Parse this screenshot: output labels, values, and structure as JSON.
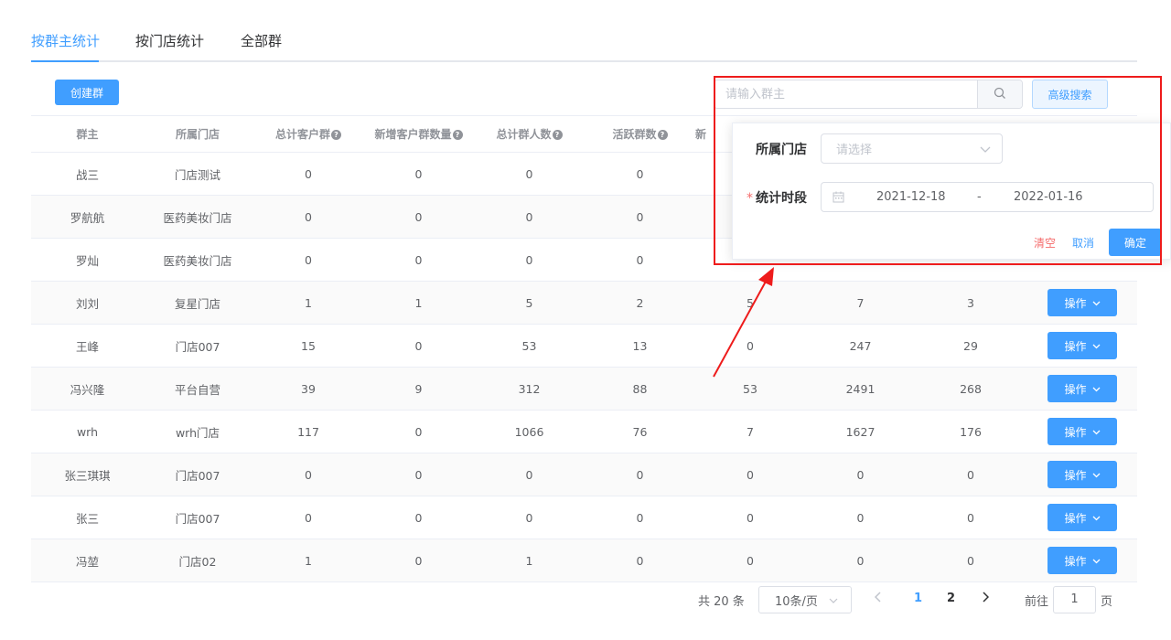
{
  "tabs": [
    {
      "label": "按群主统计",
      "active": true
    },
    {
      "label": "按门店统计",
      "active": false
    },
    {
      "label": "全部群",
      "active": false
    }
  ],
  "toolbar": {
    "create_label": "创建群"
  },
  "search": {
    "placeholder": "请输入群主",
    "value": "",
    "advanced_label": "高级搜索",
    "icon": "search-icon"
  },
  "table": {
    "columns": [
      "群主",
      "所属门店",
      "总计客户群",
      "新增客户群数量",
      "总计群人数",
      "活跃群数",
      "新",
      "",
      "",
      ""
    ],
    "help_columns": [
      2,
      3,
      4,
      5
    ],
    "rows": [
      {
        "owner": "战三",
        "store": "门店测试",
        "c1": "0",
        "c2": "0",
        "c3": "0",
        "c4": "0",
        "c5": "",
        "c6": "",
        "c7": "",
        "op": ""
      },
      {
        "owner": "罗航航",
        "store": "医药美妆门店",
        "c1": "0",
        "c2": "0",
        "c3": "0",
        "c4": "0",
        "c5": "",
        "c6": "",
        "c7": "",
        "op": ""
      },
      {
        "owner": "罗灿",
        "store": "医药美妆门店",
        "c1": "0",
        "c2": "0",
        "c3": "0",
        "c4": "0",
        "c5": "",
        "c6": "",
        "c7": "",
        "op": ""
      },
      {
        "owner": "刘刘",
        "store": "复星门店",
        "c1": "1",
        "c2": "1",
        "c3": "5",
        "c4": "2",
        "c5": "5",
        "c6": "7",
        "c7": "3",
        "op": "操作"
      },
      {
        "owner": "王峰",
        "store": "门店007",
        "c1": "15",
        "c2": "0",
        "c3": "53",
        "c4": "13",
        "c5": "0",
        "c6": "247",
        "c7": "29",
        "op": "操作"
      },
      {
        "owner": "冯兴隆",
        "store": "平台自营",
        "c1": "39",
        "c2": "9",
        "c3": "312",
        "c4": "88",
        "c5": "53",
        "c6": "2491",
        "c7": "268",
        "op": "操作"
      },
      {
        "owner": "wrh",
        "store": "wrh门店",
        "c1": "117",
        "c2": "0",
        "c3": "1066",
        "c4": "76",
        "c5": "7",
        "c6": "1627",
        "c7": "176",
        "op": "操作"
      },
      {
        "owner": "张三琪琪",
        "store": "门店007",
        "c1": "0",
        "c2": "0",
        "c3": "0",
        "c4": "0",
        "c5": "0",
        "c6": "0",
        "c7": "0",
        "op": "操作"
      },
      {
        "owner": "张三",
        "store": "门店007",
        "c1": "0",
        "c2": "0",
        "c3": "0",
        "c4": "0",
        "c5": "0",
        "c6": "0",
        "c7": "0",
        "op": "操作"
      },
      {
        "owner": "冯堃",
        "store": "门店02",
        "c1": "1",
        "c2": "0",
        "c3": "1",
        "c4": "0",
        "c5": "0",
        "c6": "0",
        "c7": "0",
        "op": "操作"
      }
    ]
  },
  "pagination": {
    "total_label": "共 20 条",
    "page_size": "10条/页",
    "pages": [
      "1",
      "2"
    ],
    "current_page": "1",
    "goto_label": "前往",
    "goto_value": "1",
    "page_unit": "页"
  },
  "advanced": {
    "store_label": "所属门店",
    "store_placeholder": "请选择",
    "period_required": "*",
    "period_label": "统计时段",
    "date_start": "2021-12-18",
    "date_sep": "-",
    "date_end": "2022-01-16",
    "clear_label": "清空",
    "cancel_label": "取消",
    "confirm_label": "确定"
  },
  "colors": {
    "primary": "#409eff",
    "danger": "#f56c6c",
    "highlight": "#ee1c1c"
  }
}
